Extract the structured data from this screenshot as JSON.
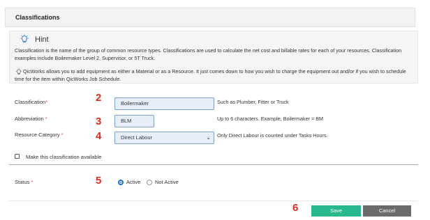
{
  "panel": {
    "title": "Classifications"
  },
  "hint": {
    "title": "Hint",
    "text1": "Classification is the name of the group of common resource types. Classifications are used to calculate the net cost and billable rates for each of your resources. Classification examples include Boilermaker Level 2, Supervisor, or 5T Truck.",
    "text2": "QicWorks allows you to add equipment as either a Material or as a Resource. It just comes down to how you wish to charge the equipment out and/or if you wish to schedule time for the item within QicWorks Job Schedule."
  },
  "form": {
    "classification": {
      "label": "Classification",
      "value": "Boilermaker",
      "help": "Such as Plumber, Fitter or Truck"
    },
    "abbreviation": {
      "label": "Abbreviation",
      "value": "BLM",
      "help": "Up to 6 characters. Example, Boilermaker = BM"
    },
    "resource_category": {
      "label": "Resource Category",
      "value": "Direct Labour",
      "help": "Only Direct Labour is counted under Tasks Hours."
    },
    "billable": {
      "label": "Make this classification available"
    },
    "status": {
      "label": "Status",
      "active": "Active",
      "not_active": "Not Active",
      "selected": "Active"
    },
    "required_mark": "*"
  },
  "annotations": {
    "n2": "2",
    "n3": "3",
    "n4": "4",
    "n5": "5",
    "n6": "6"
  },
  "buttons": {
    "save": "Save",
    "cancel": "Cancel"
  },
  "colors": {
    "save": "#27b88e",
    "cancel": "#6b6b6b",
    "marker": "#e02b20",
    "radio": "#1a6fd8"
  }
}
